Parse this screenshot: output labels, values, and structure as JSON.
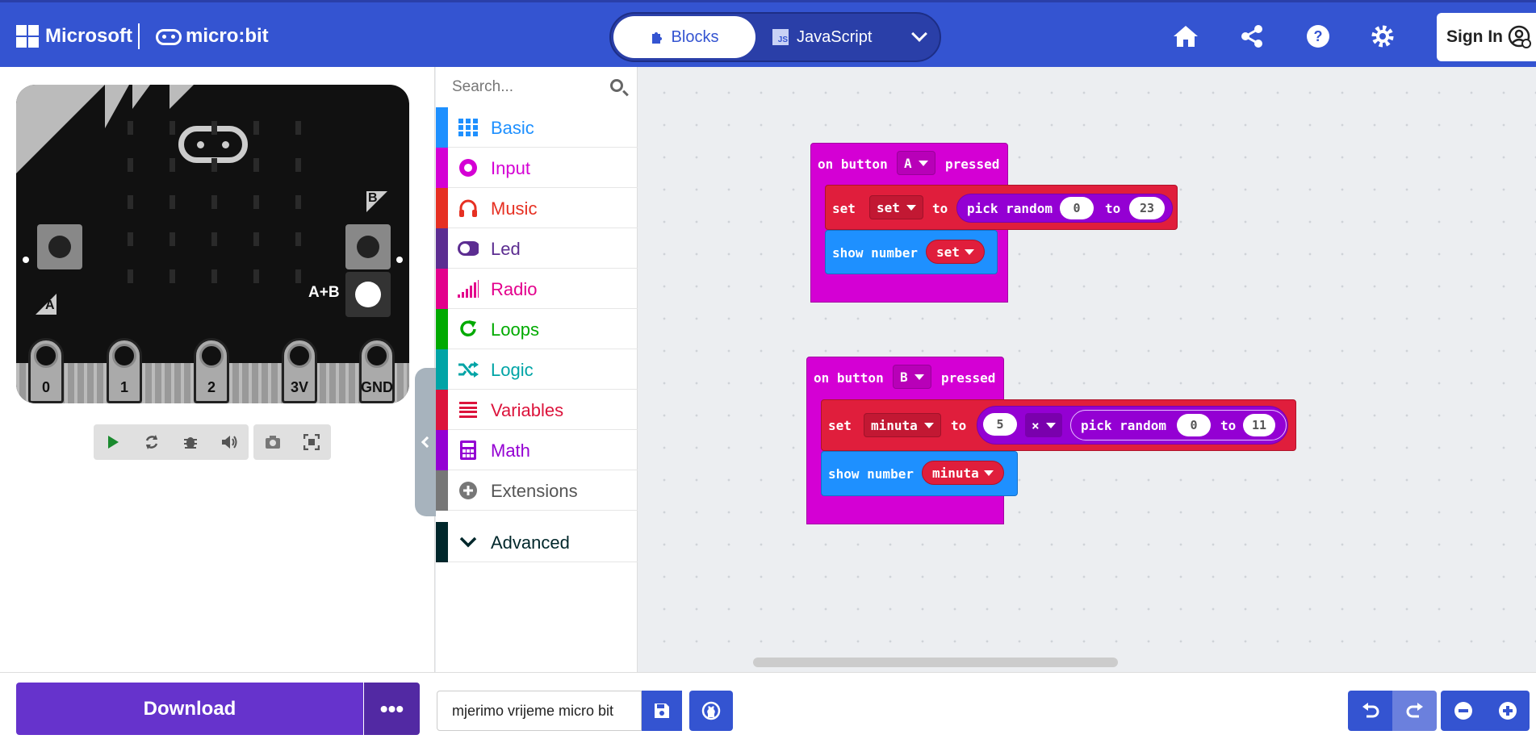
{
  "header": {
    "brand": "Microsoft",
    "product": "micro:bit",
    "mode_blocks": "Blocks",
    "mode_js": "JavaScript",
    "js_badge": "JS",
    "signin": "Sign In"
  },
  "simulator": {
    "button_a": "A",
    "button_b": "B",
    "button_ab": "A+B",
    "pins": [
      "0",
      "1",
      "2",
      "3V",
      "GND"
    ]
  },
  "toolbox": {
    "search_placeholder": "Search...",
    "categories": [
      {
        "label": "Basic",
        "color": "#1e90ff"
      },
      {
        "label": "Input",
        "color": "#d400d4"
      },
      {
        "label": "Music",
        "color": "#e63022"
      },
      {
        "label": "Led",
        "color": "#5c2d91"
      },
      {
        "label": "Radio",
        "color": "#e3008c"
      },
      {
        "label": "Loops",
        "color": "#00aa00"
      },
      {
        "label": "Logic",
        "color": "#00a4a6"
      },
      {
        "label": "Variables",
        "color": "#dc143c"
      },
      {
        "label": "Math",
        "color": "#9400d3"
      },
      {
        "label": "Extensions",
        "color": "#777777"
      },
      {
        "label": "Advanced",
        "color": "#00272b"
      }
    ]
  },
  "workspace": {
    "event_a": {
      "on": "on button",
      "button": "A",
      "pressed": "pressed"
    },
    "set_a": {
      "set": "set",
      "var": "set",
      "to": "to",
      "pick": "pick random",
      "from": "0",
      "to2": "to",
      "max": "23"
    },
    "show_a": {
      "label": "show number",
      "var": "set"
    },
    "event_b": {
      "on": "on button",
      "button": "B",
      "pressed": "pressed"
    },
    "set_b": {
      "set": "set",
      "var": "minuta",
      "to": "to",
      "factor": "5",
      "op": "×",
      "pick": "pick random",
      "from": "0",
      "to2": "to",
      "max": "11"
    },
    "show_b": {
      "label": "show number",
      "var": "minuta"
    }
  },
  "bottom": {
    "download": "Download",
    "more": "•••",
    "project_name": "mjerimo vrijeme micro bit"
  },
  "colors": {
    "header": "#3454d1",
    "download": "#6633cc",
    "input_block": "#d400d4",
    "variables_block": "#e01e3c",
    "basic_block": "#1e90ff",
    "math_block": "#9400d3"
  }
}
